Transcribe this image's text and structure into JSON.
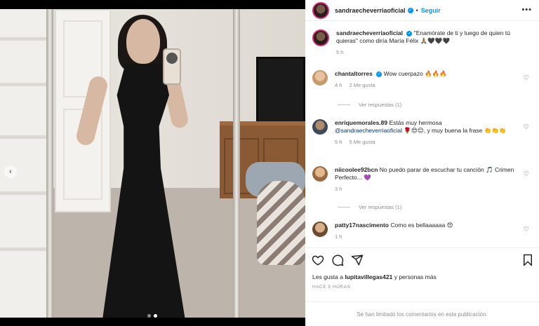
{
  "post": {
    "author": "sandraecheverriaoficial",
    "follow_label": "Seguir",
    "separator": "•",
    "more_label": "•••",
    "caption_text": "\"Enamórate de ti y luego de quien tú quieras\" como diría María Félix 🙏🏽🖤🖤🖤",
    "caption_time": "5 h",
    "carousel_dots": 2,
    "carousel_index": 1
  },
  "comments": [
    {
      "user": "chantaltorres",
      "verified": true,
      "text": "Wow cuerpazo 🔥🔥🔥",
      "time": "4 h",
      "likes": "2 Me gusta",
      "replies": "Ver respuestas (1)"
    },
    {
      "user": "enriquemorales.89",
      "verified": false,
      "text_pre": "Estás muy hermosa",
      "mention": "@sandraecheverriaoficial",
      "text_post": "🌹😍😊, y muy buena la frase 👏👏👏",
      "time": "5 h",
      "likes": "5 Me gusta",
      "replies": ""
    },
    {
      "user": "niicoolee92bcn",
      "verified": false,
      "text": "No puedo parar de escuchar tu canción 🎵 Crimen Perfecto... 💜",
      "time": "3 h",
      "likes": "",
      "replies": "Ver respuestas (1)"
    },
    {
      "user": "patty17nascimento",
      "verified": false,
      "text": "Como es bellaaaaaa 😍",
      "time": "1 h",
      "likes": "",
      "replies": ""
    }
  ],
  "footer": {
    "likes_prefix": "Les gusta a ",
    "likes_user": "lupitavillegas421",
    "likes_suffix": " y personas más",
    "time_ago": "HACE 5 HORAS",
    "comments_limited": "Se han limitado los comentarios en esta publicación."
  },
  "colors": {
    "accent": "#0095f6",
    "verified": "#0095f6",
    "muted": "#8e8e8e"
  }
}
